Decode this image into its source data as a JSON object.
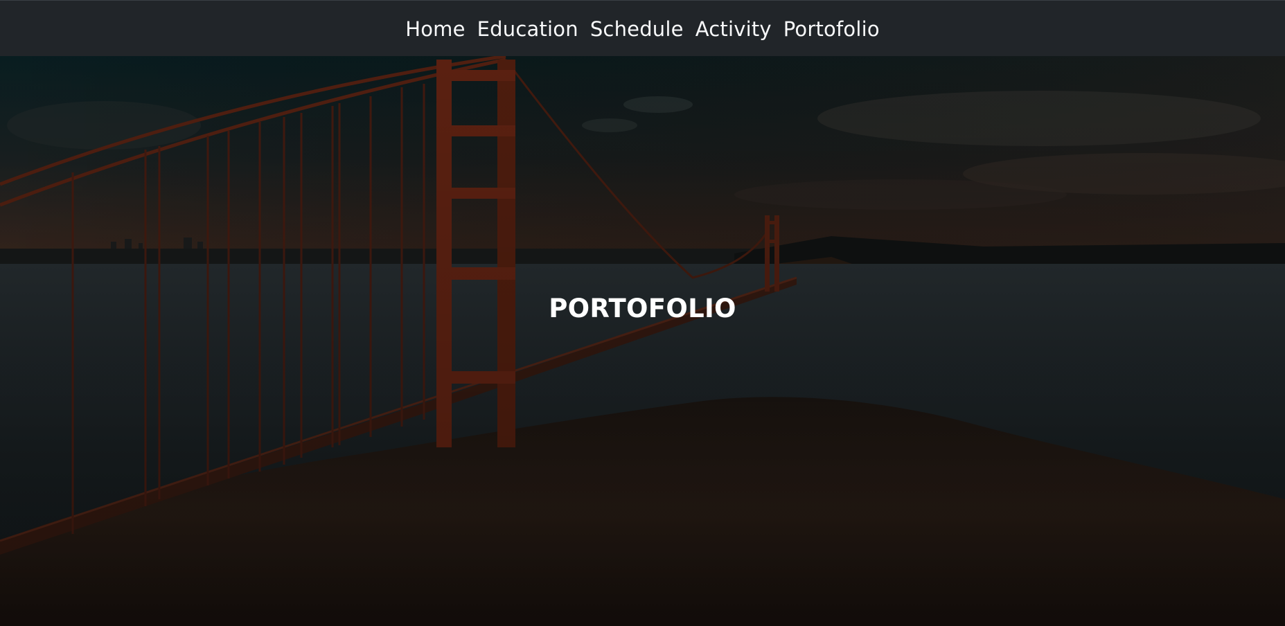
{
  "nav": {
    "items": [
      {
        "label": "Home"
      },
      {
        "label": "Education"
      },
      {
        "label": "Schedule"
      },
      {
        "label": "Activity"
      },
      {
        "label": "Portofolio"
      }
    ]
  },
  "hero": {
    "title": "PORTOFOLIO",
    "background_image": "golden-gate-bridge-sunset-photo"
  },
  "colors": {
    "navbar_bg": "#212529",
    "nav_text": "#f8f9fa",
    "hero_title": "#ffffff"
  }
}
